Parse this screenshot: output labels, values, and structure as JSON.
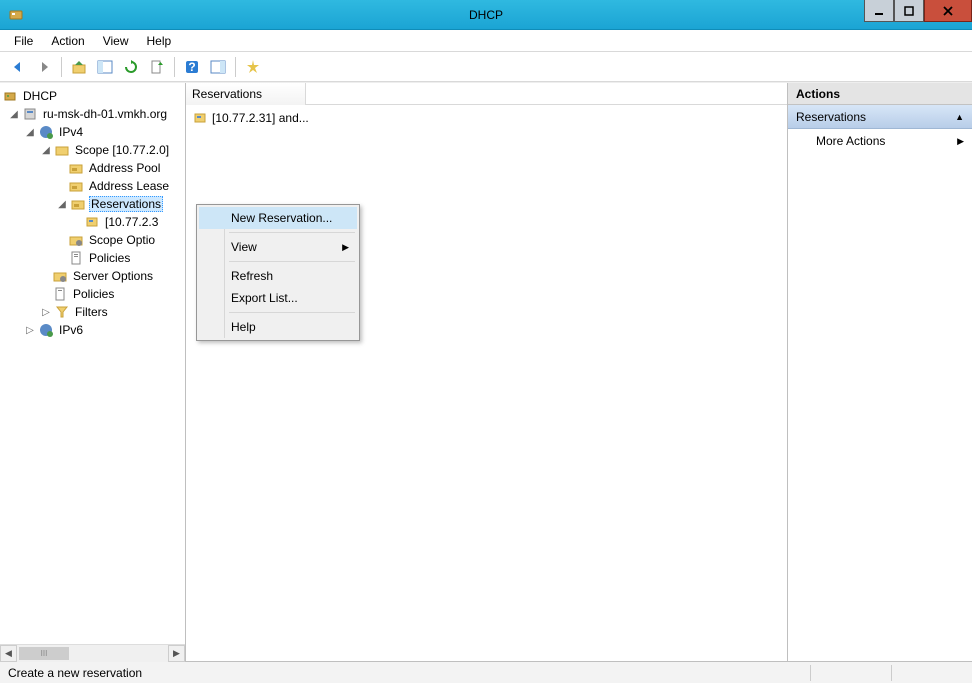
{
  "window": {
    "title": "DHCP"
  },
  "menubar": {
    "file": "File",
    "action": "Action",
    "view": "View",
    "help": "Help"
  },
  "toolbar_icons": [
    "back",
    "forward",
    "sep",
    "up",
    "show-hide-tree",
    "refresh",
    "export",
    "sep",
    "help",
    "show-hide-action",
    "sep",
    "new-reservation"
  ],
  "tree": {
    "root": "DHCP",
    "server": "ru-msk-dh-01.vmkh.org",
    "ipv4": "IPv4",
    "scope": "Scope [10.77.2.0]",
    "address_pool": "Address Pool",
    "address_leases": "Address Lease",
    "reservations": "Reservations",
    "reservation_item": "[10.77.2.3",
    "scope_options": "Scope Optio",
    "policies": "Policies",
    "server_options": "Server Options",
    "policies2": "Policies",
    "filters": "Filters",
    "ipv6": "IPv6"
  },
  "list": {
    "header": "Reservations",
    "items": [
      "[10.77.2.31] and..."
    ]
  },
  "actions": {
    "title": "Actions",
    "section": "Reservations",
    "more": "More Actions"
  },
  "context_menu": {
    "new_reservation": "New Reservation...",
    "view": "View",
    "refresh": "Refresh",
    "export_list": "Export List...",
    "help": "Help"
  },
  "statusbar": {
    "text": "Create a new reservation"
  },
  "scrollbar_label": "III"
}
